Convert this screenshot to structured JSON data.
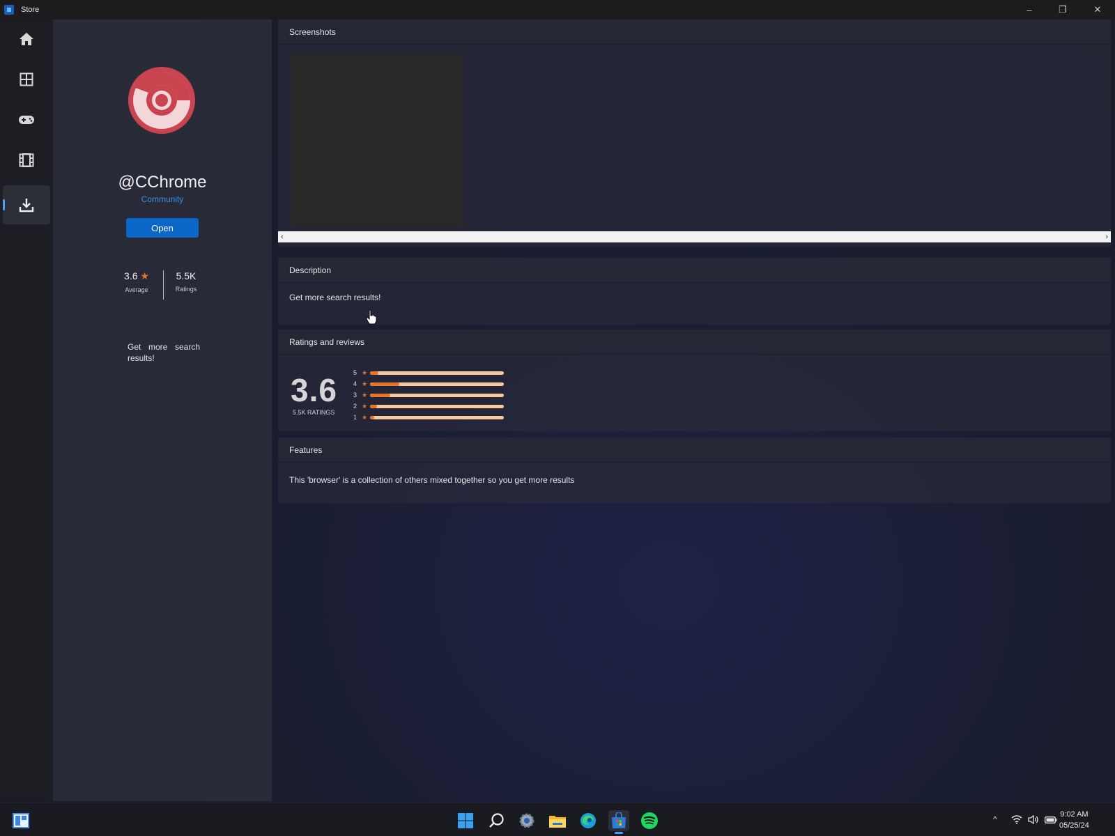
{
  "window": {
    "title": "Store",
    "minimize": "–",
    "restore": "❐",
    "close": "✕"
  },
  "nav": [
    {
      "name": "home-icon"
    },
    {
      "name": "apps-icon"
    },
    {
      "name": "gaming-icon"
    },
    {
      "name": "movies-icon"
    },
    {
      "name": "library-icon",
      "active": true
    }
  ],
  "app": {
    "name": "@CChrome",
    "publisher": "Community",
    "open_label": "Open",
    "rating_value": "3.6",
    "rating_label": "Average",
    "ratings_count": "5.5K",
    "ratings_label": "Ratings",
    "short_description": "Get more search results!"
  },
  "sections": {
    "screenshots_title": "Screenshots",
    "scroll_left": "‹",
    "scroll_right": "›",
    "description_title": "Description",
    "description_text": "Get more search results!",
    "ratings_title": "Ratings and reviews",
    "ratings_big": "3.6",
    "ratings_sub": "5.5K RATINGS",
    "features_title": "Features",
    "features_text": "This 'browser' is a collection of others mixed together so you get more results"
  },
  "rating_bars": [
    {
      "stars": "5",
      "fraction": 0.06
    },
    {
      "stars": "4",
      "fraction": 0.22
    },
    {
      "stars": "3",
      "fraction": 0.15
    },
    {
      "stars": "2",
      "fraction": 0.05
    },
    {
      "stars": "1",
      "fraction": 0.03
    }
  ],
  "colors": {
    "accent": "#0a67c7",
    "publisher_link": "#3d8fe6",
    "star": "#e8742a",
    "bar_track": "#f7c9a0",
    "logo": "#c9444f"
  },
  "taskbar": {
    "icons": [
      "widgets-icon",
      "start-icon",
      "search-icon",
      "settings-icon",
      "file-explorer-icon",
      "edge-icon",
      "store-icon",
      "spotify-icon"
    ],
    "tray_chevron": "^",
    "time": "9:02 AM",
    "date": "05/25/24"
  }
}
